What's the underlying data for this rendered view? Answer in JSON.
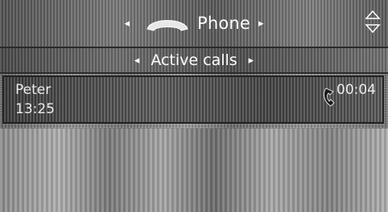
{
  "title_bar": {
    "title": "Phone",
    "icon": "handset-icon",
    "left_arrow": "◂",
    "right_arrow": "▸"
  },
  "tab_bar": {
    "label": "Active calls",
    "left_arrow": "◂",
    "right_arrow": "▸"
  },
  "call": {
    "name": "Peter",
    "time": "13:25",
    "duration": "00:04",
    "icon": "phone-call-icon"
  },
  "colors": {
    "text": "#ffffff",
    "bar_dark": "#4a4a4a",
    "border": "#2a2a2a"
  }
}
